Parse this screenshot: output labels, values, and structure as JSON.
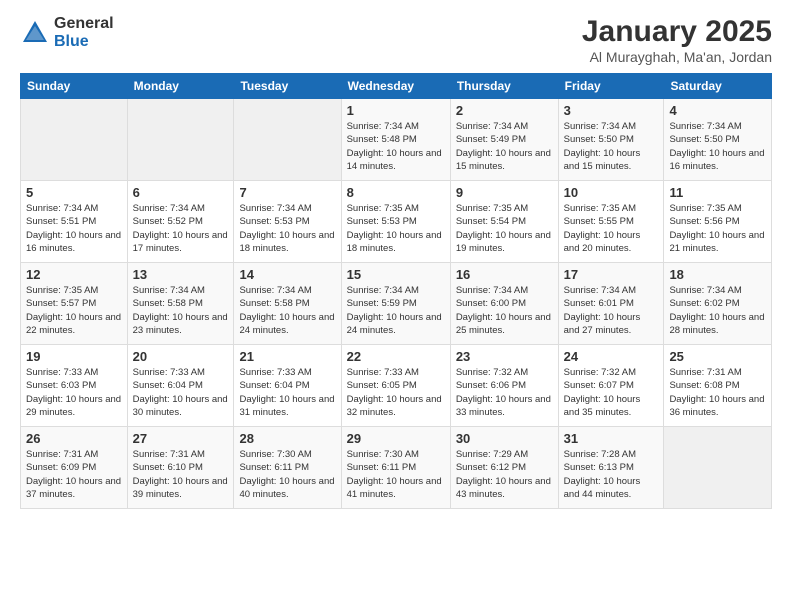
{
  "logo": {
    "general": "General",
    "blue": "Blue"
  },
  "title": "January 2025",
  "location": "Al Murayghah, Ma'an, Jordan",
  "weekdays": [
    "Sunday",
    "Monday",
    "Tuesday",
    "Wednesday",
    "Thursday",
    "Friday",
    "Saturday"
  ],
  "weeks": [
    [
      {
        "day": "",
        "sunrise": "",
        "sunset": "",
        "daylight": ""
      },
      {
        "day": "",
        "sunrise": "",
        "sunset": "",
        "daylight": ""
      },
      {
        "day": "",
        "sunrise": "",
        "sunset": "",
        "daylight": ""
      },
      {
        "day": "1",
        "sunrise": "Sunrise: 7:34 AM",
        "sunset": "Sunset: 5:48 PM",
        "daylight": "Daylight: 10 hours and 14 minutes."
      },
      {
        "day": "2",
        "sunrise": "Sunrise: 7:34 AM",
        "sunset": "Sunset: 5:49 PM",
        "daylight": "Daylight: 10 hours and 15 minutes."
      },
      {
        "day": "3",
        "sunrise": "Sunrise: 7:34 AM",
        "sunset": "Sunset: 5:50 PM",
        "daylight": "Daylight: 10 hours and 15 minutes."
      },
      {
        "day": "4",
        "sunrise": "Sunrise: 7:34 AM",
        "sunset": "Sunset: 5:50 PM",
        "daylight": "Daylight: 10 hours and 16 minutes."
      }
    ],
    [
      {
        "day": "5",
        "sunrise": "Sunrise: 7:34 AM",
        "sunset": "Sunset: 5:51 PM",
        "daylight": "Daylight: 10 hours and 16 minutes."
      },
      {
        "day": "6",
        "sunrise": "Sunrise: 7:34 AM",
        "sunset": "Sunset: 5:52 PM",
        "daylight": "Daylight: 10 hours and 17 minutes."
      },
      {
        "day": "7",
        "sunrise": "Sunrise: 7:34 AM",
        "sunset": "Sunset: 5:53 PM",
        "daylight": "Daylight: 10 hours and 18 minutes."
      },
      {
        "day": "8",
        "sunrise": "Sunrise: 7:35 AM",
        "sunset": "Sunset: 5:53 PM",
        "daylight": "Daylight: 10 hours and 18 minutes."
      },
      {
        "day": "9",
        "sunrise": "Sunrise: 7:35 AM",
        "sunset": "Sunset: 5:54 PM",
        "daylight": "Daylight: 10 hours and 19 minutes."
      },
      {
        "day": "10",
        "sunrise": "Sunrise: 7:35 AM",
        "sunset": "Sunset: 5:55 PM",
        "daylight": "Daylight: 10 hours and 20 minutes."
      },
      {
        "day": "11",
        "sunrise": "Sunrise: 7:35 AM",
        "sunset": "Sunset: 5:56 PM",
        "daylight": "Daylight: 10 hours and 21 minutes."
      }
    ],
    [
      {
        "day": "12",
        "sunrise": "Sunrise: 7:35 AM",
        "sunset": "Sunset: 5:57 PM",
        "daylight": "Daylight: 10 hours and 22 minutes."
      },
      {
        "day": "13",
        "sunrise": "Sunrise: 7:34 AM",
        "sunset": "Sunset: 5:58 PM",
        "daylight": "Daylight: 10 hours and 23 minutes."
      },
      {
        "day": "14",
        "sunrise": "Sunrise: 7:34 AM",
        "sunset": "Sunset: 5:58 PM",
        "daylight": "Daylight: 10 hours and 24 minutes."
      },
      {
        "day": "15",
        "sunrise": "Sunrise: 7:34 AM",
        "sunset": "Sunset: 5:59 PM",
        "daylight": "Daylight: 10 hours and 24 minutes."
      },
      {
        "day": "16",
        "sunrise": "Sunrise: 7:34 AM",
        "sunset": "Sunset: 6:00 PM",
        "daylight": "Daylight: 10 hours and 25 minutes."
      },
      {
        "day": "17",
        "sunrise": "Sunrise: 7:34 AM",
        "sunset": "Sunset: 6:01 PM",
        "daylight": "Daylight: 10 hours and 27 minutes."
      },
      {
        "day": "18",
        "sunrise": "Sunrise: 7:34 AM",
        "sunset": "Sunset: 6:02 PM",
        "daylight": "Daylight: 10 hours and 28 minutes."
      }
    ],
    [
      {
        "day": "19",
        "sunrise": "Sunrise: 7:33 AM",
        "sunset": "Sunset: 6:03 PM",
        "daylight": "Daylight: 10 hours and 29 minutes."
      },
      {
        "day": "20",
        "sunrise": "Sunrise: 7:33 AM",
        "sunset": "Sunset: 6:04 PM",
        "daylight": "Daylight: 10 hours and 30 minutes."
      },
      {
        "day": "21",
        "sunrise": "Sunrise: 7:33 AM",
        "sunset": "Sunset: 6:04 PM",
        "daylight": "Daylight: 10 hours and 31 minutes."
      },
      {
        "day": "22",
        "sunrise": "Sunrise: 7:33 AM",
        "sunset": "Sunset: 6:05 PM",
        "daylight": "Daylight: 10 hours and 32 minutes."
      },
      {
        "day": "23",
        "sunrise": "Sunrise: 7:32 AM",
        "sunset": "Sunset: 6:06 PM",
        "daylight": "Daylight: 10 hours and 33 minutes."
      },
      {
        "day": "24",
        "sunrise": "Sunrise: 7:32 AM",
        "sunset": "Sunset: 6:07 PM",
        "daylight": "Daylight: 10 hours and 35 minutes."
      },
      {
        "day": "25",
        "sunrise": "Sunrise: 7:31 AM",
        "sunset": "Sunset: 6:08 PM",
        "daylight": "Daylight: 10 hours and 36 minutes."
      }
    ],
    [
      {
        "day": "26",
        "sunrise": "Sunrise: 7:31 AM",
        "sunset": "Sunset: 6:09 PM",
        "daylight": "Daylight: 10 hours and 37 minutes."
      },
      {
        "day": "27",
        "sunrise": "Sunrise: 7:31 AM",
        "sunset": "Sunset: 6:10 PM",
        "daylight": "Daylight: 10 hours and 39 minutes."
      },
      {
        "day": "28",
        "sunrise": "Sunrise: 7:30 AM",
        "sunset": "Sunset: 6:11 PM",
        "daylight": "Daylight: 10 hours and 40 minutes."
      },
      {
        "day": "29",
        "sunrise": "Sunrise: 7:30 AM",
        "sunset": "Sunset: 6:11 PM",
        "daylight": "Daylight: 10 hours and 41 minutes."
      },
      {
        "day": "30",
        "sunrise": "Sunrise: 7:29 AM",
        "sunset": "Sunset: 6:12 PM",
        "daylight": "Daylight: 10 hours and 43 minutes."
      },
      {
        "day": "31",
        "sunrise": "Sunrise: 7:28 AM",
        "sunset": "Sunset: 6:13 PM",
        "daylight": "Daylight: 10 hours and 44 minutes."
      },
      {
        "day": "",
        "sunrise": "",
        "sunset": "",
        "daylight": ""
      }
    ]
  ]
}
